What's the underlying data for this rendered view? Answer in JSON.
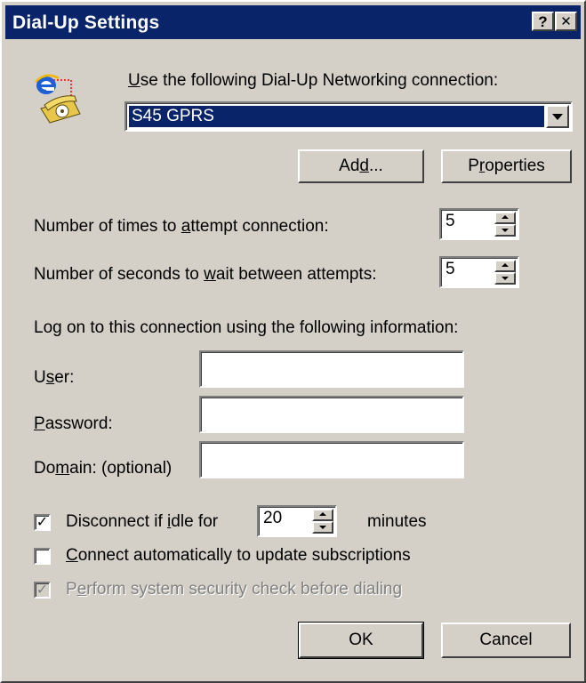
{
  "window": {
    "title": "Dial-Up Settings",
    "help_button": "?",
    "close_button": "✕"
  },
  "connection": {
    "label_prefix": "",
    "label_accel": "U",
    "label_rest": "se the following Dial-Up Networking connection:",
    "selected": "S45 GPRS",
    "add_label_pre": "Ad",
    "add_label_accel": "d",
    "add_label_post": "...",
    "properties_label_pre": "P",
    "properties_label_accel": "r",
    "properties_label_post": "operties"
  },
  "attempts": {
    "label_pre": "Number of times to ",
    "label_accel": "a",
    "label_post": "ttempt connection:",
    "value": "5"
  },
  "wait": {
    "label_pre": "Number of seconds to ",
    "label_accel": "w",
    "label_post": "ait between attempts:",
    "value": "5"
  },
  "logon": {
    "heading": "Log on to this connection using the following information:",
    "user_pre": "U",
    "user_accel": "s",
    "user_post": "er:",
    "user_value": "",
    "password_pre": "",
    "password_accel": "P",
    "password_post": "assword:",
    "password_value": "",
    "domain_pre": "Do",
    "domain_accel": "m",
    "domain_post": "ain: (optional)",
    "domain_value": ""
  },
  "options": {
    "disconnect_checked": true,
    "disconnect_pre": "Disconnect if ",
    "disconnect_accel": "i",
    "disconnect_post": "dle for",
    "idle_value": "20",
    "minutes_label": "minutes",
    "connect_auto_checked": false,
    "connect_auto_pre": "",
    "connect_auto_accel": "C",
    "connect_auto_post": "onnect automatically to update subscriptions",
    "security_checked": true,
    "security_disabled": true,
    "security_pre": "P",
    "security_accel": "e",
    "security_post": "rform system security check before dialing",
    "check_glyph": "✓"
  },
  "footer": {
    "ok_label": "OK",
    "cancel_label": "Cancel"
  },
  "colors": {
    "titlebar": "#0a246a",
    "face": "#d4d0c8",
    "selection": "#0a246a"
  },
  "icons": [
    "internet-explorer-icon",
    "telephone-icon"
  ]
}
